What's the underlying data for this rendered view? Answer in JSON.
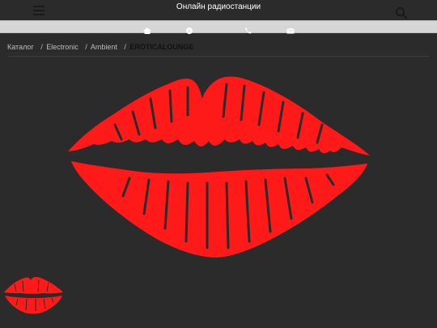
{
  "header": {
    "title": "Онлайн радиостанции",
    "menu_icon": "hamburger-menu-icon",
    "search_icon": "search-icon"
  },
  "nav": {
    "icons": [
      "home-icon",
      "info-icon",
      "phone-icon",
      "mail-icon"
    ]
  },
  "breadcrumb": {
    "items": [
      "Каталог",
      "Electronic",
      "Ambient"
    ],
    "current": "EROTICALOUNGE"
  },
  "colors": {
    "background": "#2b2b2b",
    "lips": "#ff1a1a",
    "nav_background": "#d6d6d6"
  },
  "images": {
    "hero": "red-lips-logo",
    "thumbnail": "red-lips-thumbnail"
  }
}
